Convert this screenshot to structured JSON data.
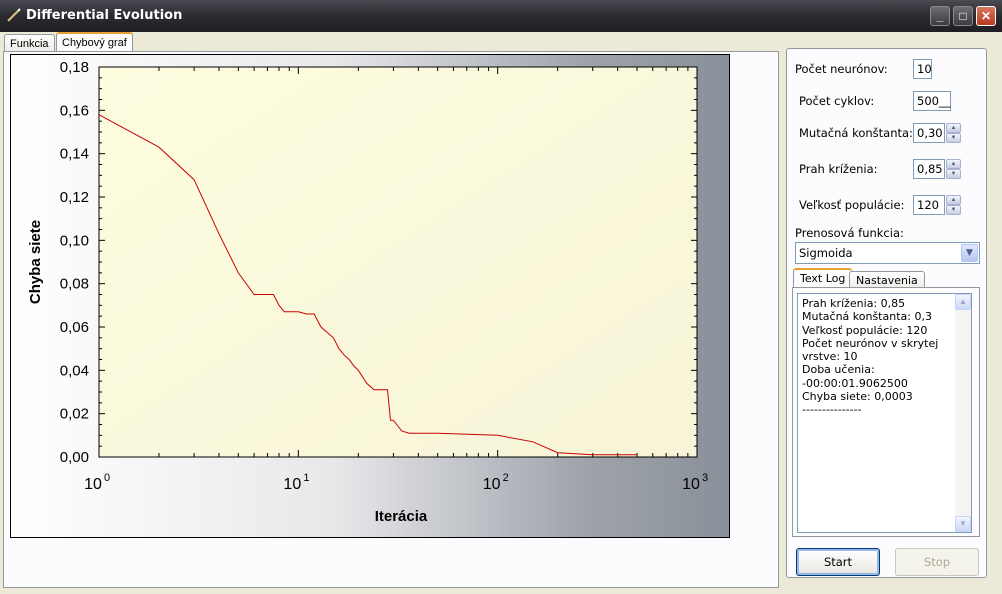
{
  "window": {
    "title": "Differential Evolution"
  },
  "tabs": [
    {
      "label": "Funkcia"
    },
    {
      "label": "Chybový graf"
    }
  ],
  "chart_data": {
    "type": "line",
    "xscale": "log",
    "xlim": [
      1,
      1000
    ],
    "ylim": [
      0,
      0.18
    ],
    "xlabel": "Iterácia",
    "ylabel": "Chyba siete",
    "x_tick_labels": [
      "10^0",
      "10^1",
      "10^2",
      "10^3"
    ],
    "y_tick_labels": [
      "0,00",
      "0,02",
      "0,04",
      "0,06",
      "0,08",
      "0,10",
      "0,12",
      "0,14",
      "0,16",
      "0,18"
    ],
    "series": [
      {
        "color": "#cc0000",
        "x": [
          1,
          2,
          3,
          4,
          5,
          6,
          7.5,
          8,
          8.5,
          10,
          11,
          12,
          13,
          15,
          16,
          17,
          18,
          19,
          20,
          21,
          22,
          24,
          28,
          29,
          30,
          33,
          36,
          50,
          100,
          150,
          200,
          300,
          500
        ],
        "y": [
          0.158,
          0.143,
          0.128,
          0.103,
          0.085,
          0.075,
          0.075,
          0.07,
          0.067,
          0.067,
          0.066,
          0.066,
          0.06,
          0.055,
          0.05,
          0.047,
          0.045,
          0.042,
          0.04,
          0.037,
          0.034,
          0.031,
          0.031,
          0.017,
          0.017,
          0.012,
          0.011,
          0.011,
          0.01,
          0.007,
          0.002,
          0.001,
          0.001
        ]
      }
    ]
  },
  "settings": {
    "neurons": {
      "label": "Počet neurónov:",
      "value": "10"
    },
    "cycles": {
      "label": "Počet cyklov:",
      "value": "500__"
    },
    "mutation": {
      "label": "Mutačná konštanta:",
      "value": "0,30"
    },
    "crossover": {
      "label": "Prah kríženia:",
      "value": "0,85"
    },
    "population": {
      "label": "Veľkosť populácie:",
      "value": "120"
    },
    "transfer": {
      "label": "Prenosová funkcia:",
      "value": "Sigmoida"
    }
  },
  "subtabs": [
    {
      "label": "Text Log"
    },
    {
      "label": "Nastavenia"
    }
  ],
  "log_lines": [
    "Prah kríženia: 0,85",
    "Mutačná konštanta: 0,3",
    "Veľkosť populácie: 120",
    "Počet neurónov v skrytej",
    "vrstve: 10",
    "Doba učenia:",
    "-00:00:01.9062500",
    "Chyba siete: 0,0003",
    "---------------"
  ],
  "buttons": {
    "start": "Start",
    "stop": "Stop"
  }
}
